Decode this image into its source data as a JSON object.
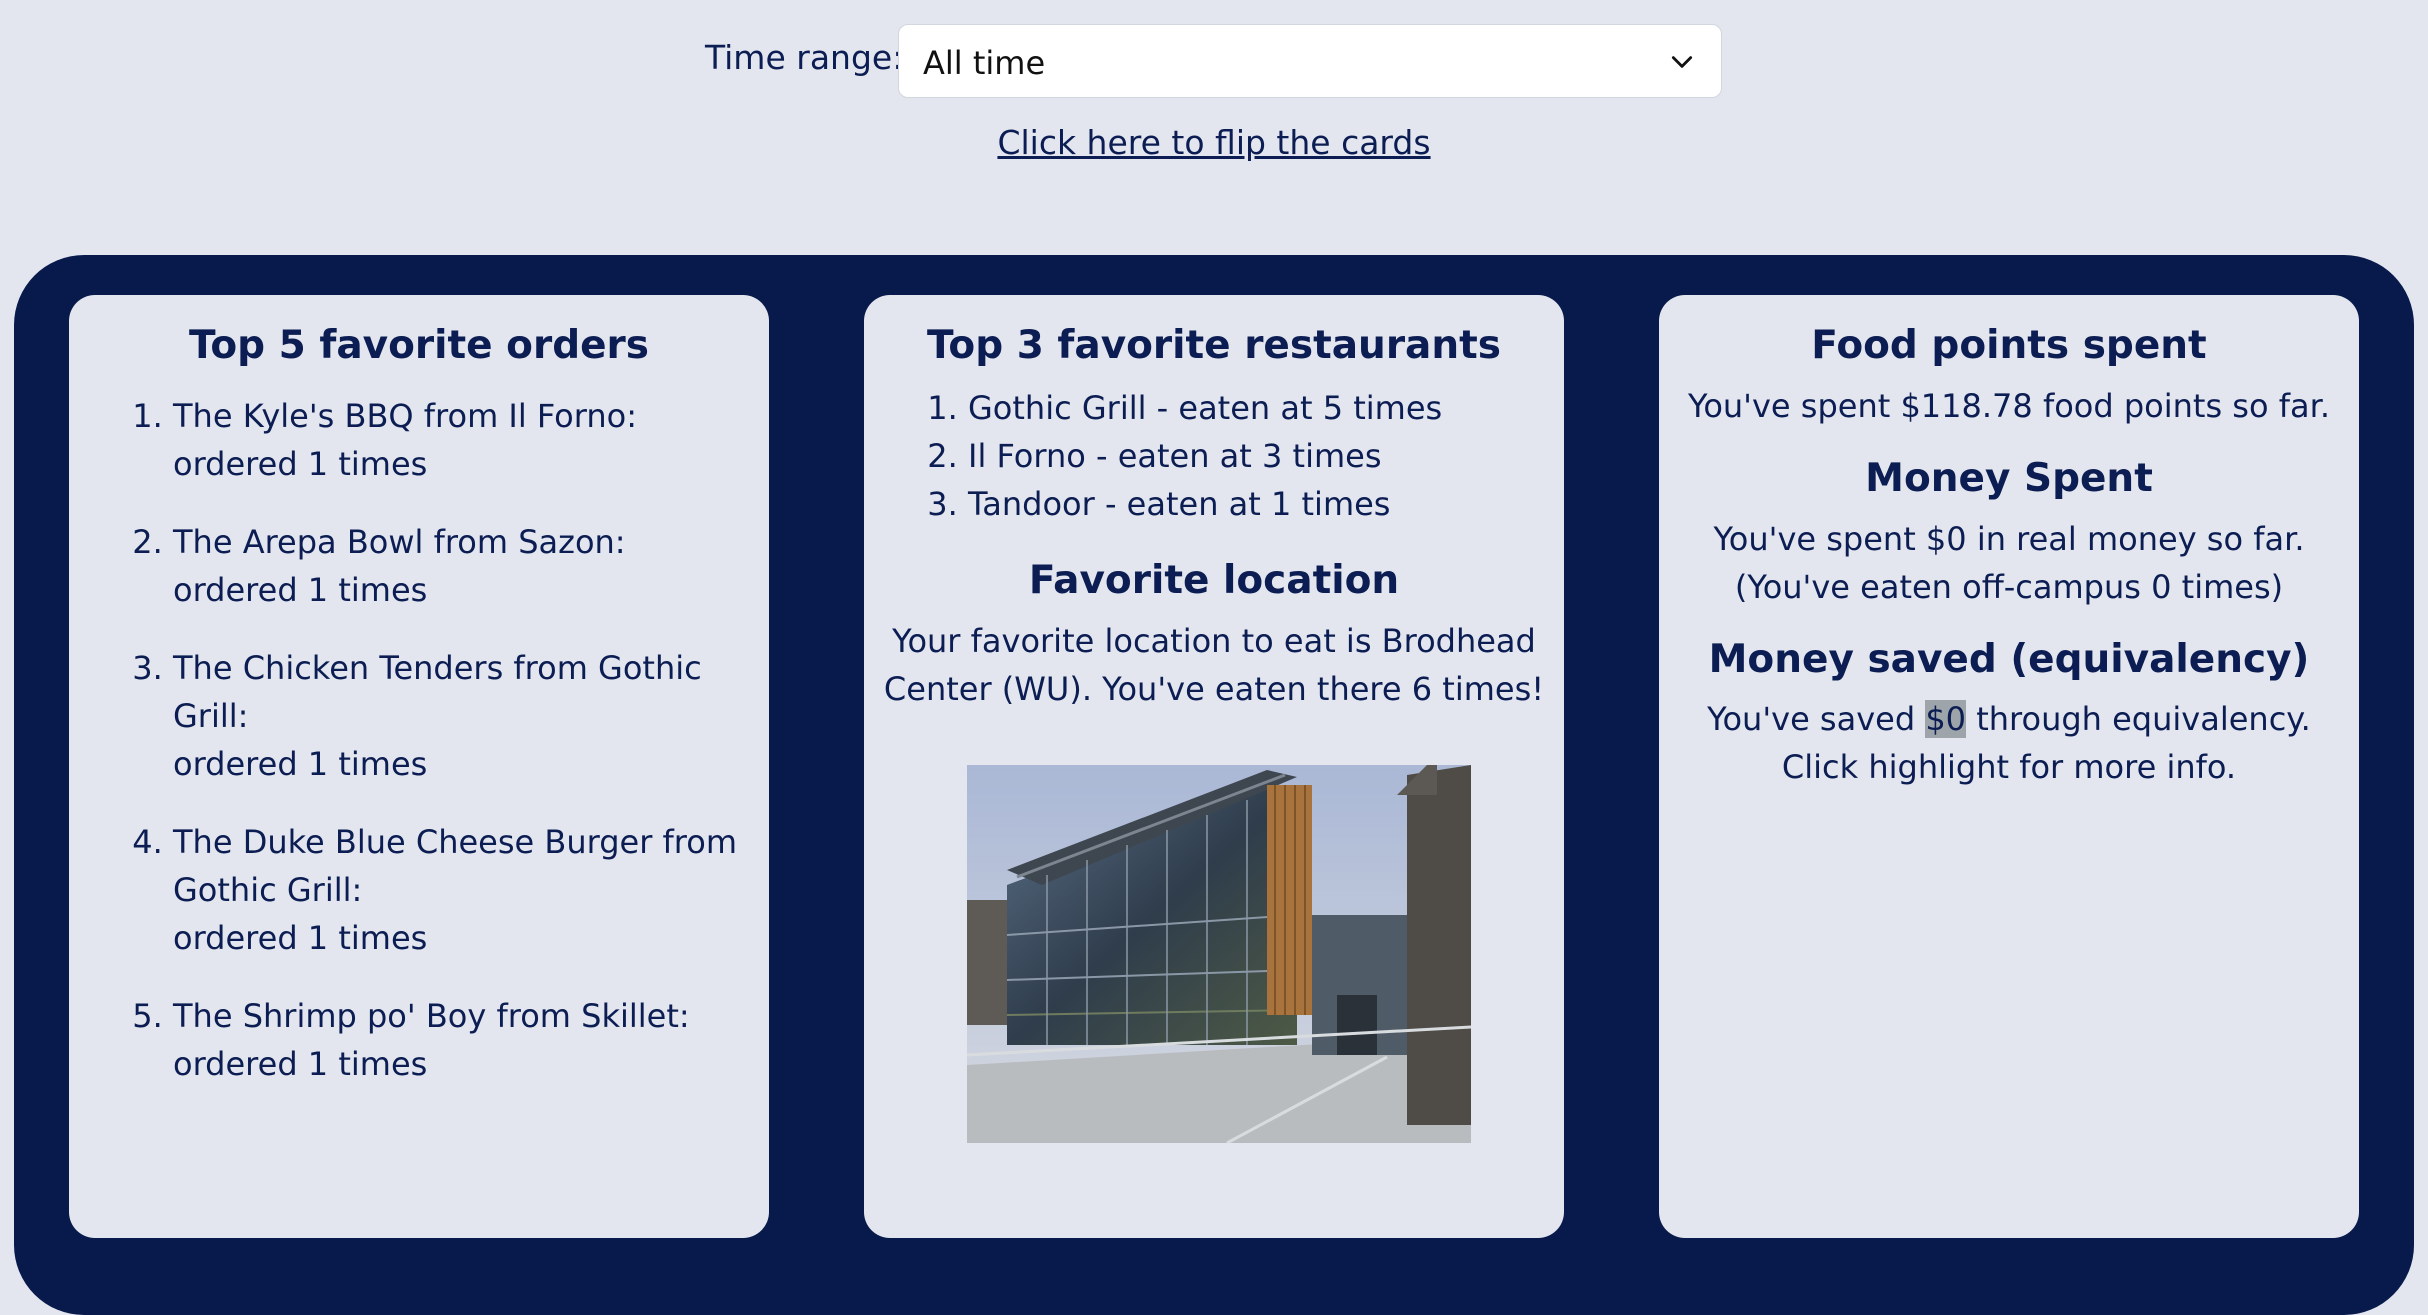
{
  "controls": {
    "time_range_label": "Time range:",
    "time_range_value": "All time",
    "flip_link": "Click here to flip the cards"
  },
  "orders_card": {
    "title": "Top 5 favorite orders",
    "items": [
      {
        "line1": "The Kyle's BBQ from Il Forno:",
        "line2": "ordered 1 times"
      },
      {
        "line1": "The Arepa Bowl from Sazon:",
        "line2": "ordered 1 times"
      },
      {
        "line1": "The Chicken Tenders from Gothic Grill:",
        "line2": "ordered 1 times"
      },
      {
        "line1": "The Duke Blue Cheese Burger from Gothic Grill:",
        "line2": "ordered 1 times"
      },
      {
        "line1": "The Shrimp po' Boy from Skillet:",
        "line2": "ordered 1 times"
      }
    ]
  },
  "restaurants_card": {
    "title": "Top 3 favorite restaurants",
    "items": [
      "Gothic Grill - eaten at 5 times",
      "Il Forno - eaten at 3 times",
      "Tandoor - eaten at 1 times"
    ],
    "location_title": "Favorite location",
    "location_text": "Your favorite location to eat is Brodhead Center (WU). You've eaten there 6 times!"
  },
  "spending_card": {
    "food_points_title": "Food points spent",
    "food_points_text": "You've spent $118.78 food points so far.",
    "money_title": "Money Spent",
    "money_line1": "You've spent $0 in real money so far.",
    "money_line2": "(You've eaten off-campus 0 times)",
    "saved_title": "Money saved (equivalency)",
    "saved_prefix": "You've saved ",
    "saved_amount": "$0",
    "saved_suffix": " through equivalency.",
    "saved_line2": "Click highlight for more info."
  },
  "colors": {
    "page_bg": "#e3e6ee",
    "board_bg": "#081a4b",
    "text": "#0b1d52",
    "highlight": "#9ea5aa"
  }
}
